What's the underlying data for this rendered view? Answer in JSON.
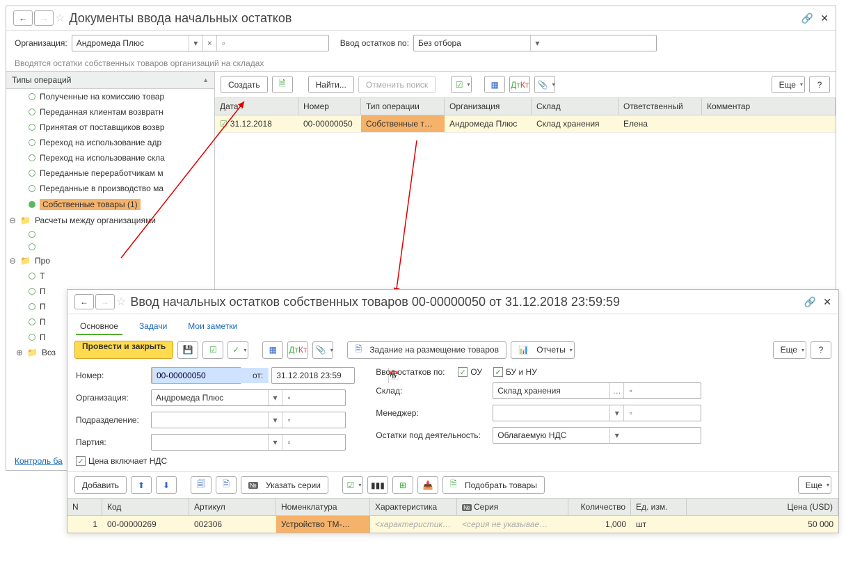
{
  "win1": {
    "title": "Документы ввода начальных остатков",
    "org_label": "Организация:",
    "org_value": "Андромеда Плюс",
    "filter_label": "Ввод остатков по:",
    "filter_value": "Без отбора",
    "hint": "Вводятся остатки собственных товаров организаций на складах",
    "tree_header": "Типы операций",
    "tree": [
      "Полученные на комиссию товар",
      "Переданная клиентам возвратн",
      "Принятая от поставщиков возвр",
      "Переход на использование адр",
      "Переход на использование скла",
      "Переданные переработчикам м",
      "Переданные в производство ма"
    ],
    "tree_selected": "Собственные товары (1)",
    "tree_folders": [
      "Расчеты между организациями",
      "Про",
      "Воз"
    ],
    "tree_sub": [
      "Т",
      "П",
      "П",
      "П",
      "П"
    ],
    "toolbar": {
      "create": "Создать",
      "find": "Найти...",
      "cancel": "Отменить поиск",
      "more": "Еще"
    },
    "cols": [
      "Дата",
      "Номер",
      "Тип операции",
      "Организация",
      "Склад",
      "Ответственный",
      "Комментар"
    ],
    "row": {
      "date": "31.12.2018",
      "num": "00-00000050",
      "type": "Собственные т…",
      "org": "Андромеда Плюс",
      "wh": "Склад хранения",
      "resp": "Елена"
    },
    "link": "Контроль ба"
  },
  "win2": {
    "title": "Ввод начальных остатков собственных товаров 00-00000050 от 31.12.2018 23:59:59",
    "tabs": [
      "Основное",
      "Задачи",
      "Мои заметки"
    ],
    "mainbtn": "Провести и закрыть",
    "task_btn": "Задание на размещение товаров",
    "reports": "Отчеты",
    "more": "Еще",
    "number_lbl": "Номер:",
    "number_val": "00-00000050",
    "from_lbl": "от:",
    "date_val": "31.12.2018 23:59",
    "org_lbl": "Организация:",
    "org_val": "Андромеда Плюс",
    "dept_lbl": "Подразделение:",
    "party_lbl": "Партия:",
    "ost_lbl": "Ввод остатков по:",
    "chk_ou": "ОУ",
    "chk_bu": "БУ и НУ",
    "wh_lbl": "Склад:",
    "wh_val": "Склад хранения",
    "mgr_lbl": "Менеджер:",
    "act_lbl": "Остатки под деятельность:",
    "act_val": "Облагаемую НДС",
    "vat_lbl": "Цена включает НДС",
    "tb3": {
      "add": "Добавить",
      "series": "Указать серии",
      "pick": "Подобрать товары",
      "more": "Еще"
    },
    "cols": [
      "N",
      "Код",
      "Артикул",
      "Номенклатура",
      "Характеристика",
      "Серия",
      "Количество",
      "Ед. изм.",
      "Цена (USD)"
    ],
    "num_hdr_icon": "№",
    "row": {
      "n": "1",
      "code": "00-00000269",
      "art": "002306",
      "nom": "Устройство ТМ-…",
      "char": "<характеристик…",
      "ser": "<серия не указывае…",
      "qty": "1,000",
      "unit": "шт",
      "price": "50 000"
    }
  }
}
